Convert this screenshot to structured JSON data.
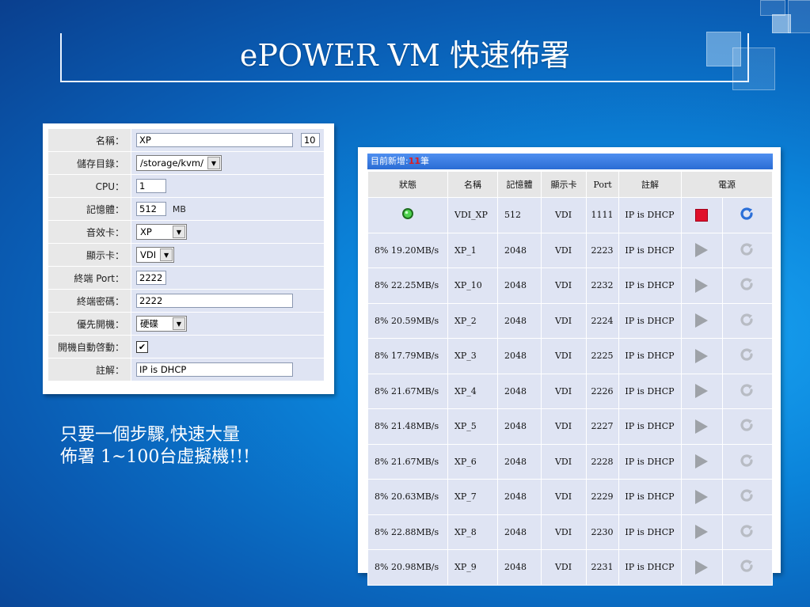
{
  "title": "ePOWER  VM 快速佈署",
  "slogan": [
    "只要一個步驟,快速大量",
    "佈署 1~100台虛擬機!!!"
  ],
  "form": {
    "rows": [
      {
        "label": "名稱：",
        "value": "XP",
        "extra": "10"
      },
      {
        "label": "儲存目錄：",
        "value": "/storage/kvm/"
      },
      {
        "label": "CPU：",
        "value": "1"
      },
      {
        "label": "記憶體：",
        "value": "512",
        "unit": "MB"
      },
      {
        "label": "音效卡：",
        "value": "XP"
      },
      {
        "label": "顯示卡：",
        "value": "VDI"
      },
      {
        "label": "終端 Port：",
        "value": "2222"
      },
      {
        "label": "終端密碼：",
        "value": "2222"
      },
      {
        "label": "優先開機：",
        "value": "硬碟"
      },
      {
        "label": "開機自動啓動：",
        "value": "checked"
      },
      {
        "label": "註解：",
        "value": "IP is DHCP"
      }
    ]
  },
  "vm": {
    "header_prefix": "目前新增:",
    "header_count": "11",
    "header_suffix": "筆",
    "columns": [
      "狀態",
      "名稱",
      "記憶體",
      "顯示卡",
      "Port",
      "註解",
      "電源"
    ],
    "rows": [
      {
        "status": "running",
        "name": "VDI_XP",
        "memory": "512",
        "display": "VDI",
        "port": "1111",
        "note": "IP is DHCP",
        "running": true
      },
      {
        "status": "8% 19.20MB/s",
        "name": "XP_1",
        "memory": "2048",
        "display": "VDI",
        "port": "2223",
        "note": "IP is DHCP"
      },
      {
        "status": "8% 22.25MB/s",
        "name": "XP_10",
        "memory": "2048",
        "display": "VDI",
        "port": "2232",
        "note": "IP is DHCP"
      },
      {
        "status": "8% 20.59MB/s",
        "name": "XP_2",
        "memory": "2048",
        "display": "VDI",
        "port": "2224",
        "note": "IP is DHCP"
      },
      {
        "status": "8% 17.79MB/s",
        "name": "XP_3",
        "memory": "2048",
        "display": "VDI",
        "port": "2225",
        "note": "IP is DHCP"
      },
      {
        "status": "8% 21.67MB/s",
        "name": "XP_4",
        "memory": "2048",
        "display": "VDI",
        "port": "2226",
        "note": "IP is DHCP"
      },
      {
        "status": "8% 21.48MB/s",
        "name": "XP_5",
        "memory": "2048",
        "display": "VDI",
        "port": "2227",
        "note": "IP is DHCP"
      },
      {
        "status": "8% 21.67MB/s",
        "name": "XP_6",
        "memory": "2048",
        "display": "VDI",
        "port": "2228",
        "note": "IP is DHCP"
      },
      {
        "status": "8% 20.63MB/s",
        "name": "XP_7",
        "memory": "2048",
        "display": "VDI",
        "port": "2229",
        "note": "IP is DHCP"
      },
      {
        "status": "8% 22.88MB/s",
        "name": "XP_8",
        "memory": "2048",
        "display": "VDI",
        "port": "2230",
        "note": "IP is DHCP"
      },
      {
        "status": "8% 20.98MB/s",
        "name": "XP_9",
        "memory": "2048",
        "display": "VDI",
        "port": "2231",
        "note": "IP is DHCP"
      }
    ]
  },
  "colors": {
    "accent": "#2a6cd4",
    "stop": "#e0102a",
    "count": "#e21d1d"
  }
}
